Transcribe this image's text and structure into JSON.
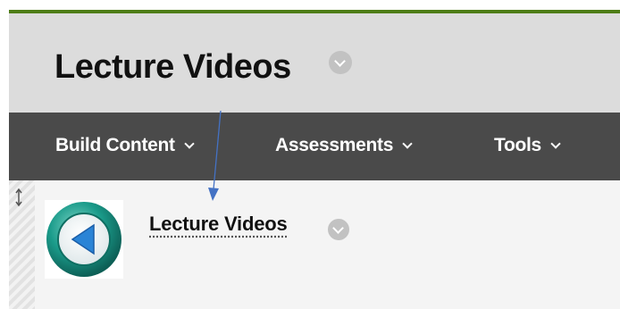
{
  "page": {
    "title": "Lecture Videos"
  },
  "menu": {
    "items": [
      {
        "label": "Build Content"
      },
      {
        "label": "Assessments"
      },
      {
        "label": "Tools"
      }
    ]
  },
  "content": {
    "item_title": "Lecture Videos"
  },
  "colors": {
    "accent_green": "#4e7d17",
    "menu_bg": "#4a4a4a",
    "title_bg": "#dcdcdc",
    "icon_teal": "#1a9b8a",
    "annotation_blue": "#4472c4"
  }
}
